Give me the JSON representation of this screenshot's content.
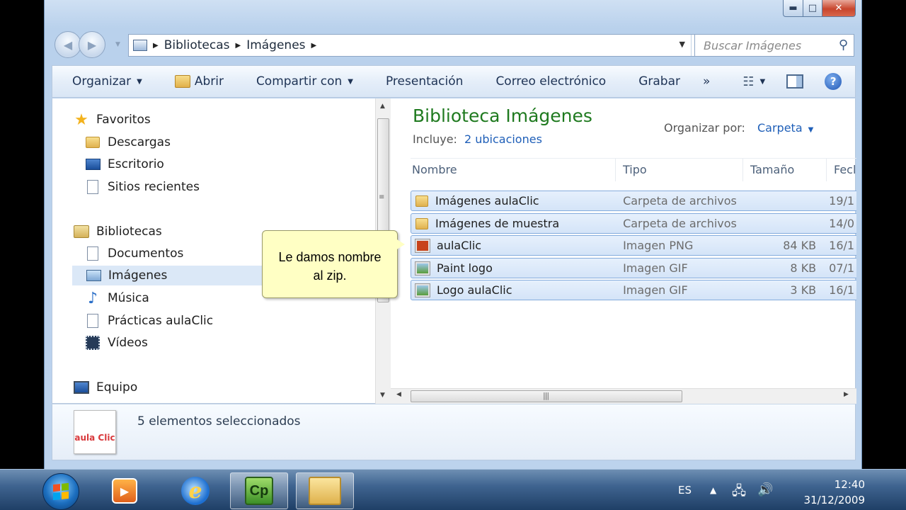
{
  "window": {
    "controls": {
      "minimize": "▬",
      "maximize": "□",
      "close": "✕"
    }
  },
  "address": {
    "crumbs": [
      "Bibliotecas",
      "Imágenes"
    ],
    "search_placeholder": "Buscar Imágenes"
  },
  "toolbar": {
    "organize": "Organizar",
    "open": "Abrir",
    "share": "Compartir con",
    "slideshow": "Presentación",
    "email": "Correo electrónico",
    "burn": "Grabar",
    "more": "»"
  },
  "nav": {
    "favorites": "Favoritos",
    "downloads": "Descargas",
    "desktop": "Escritorio",
    "recent": "Sitios recientes",
    "libraries": "Bibliotecas",
    "documents": "Documentos",
    "images": "Imágenes",
    "music": "Música",
    "practicas": "Prácticas aulaClic",
    "videos": "Vídeos",
    "computer": "Equipo"
  },
  "content": {
    "title": "Biblioteca Imágenes",
    "includes_label": "Incluye:",
    "includes_link": "2 ubicaciones",
    "arrange_label": "Organizar por:",
    "arrange_value": "Carpeta",
    "columns": [
      "Nombre",
      "Tipo",
      "Tamaño",
      "Fecl"
    ],
    "files": [
      {
        "name": "Imágenes aulaClic",
        "type": "Carpeta de archivos",
        "size": "",
        "date": "19/1",
        "icon": "folder-icon"
      },
      {
        "name": "Imágenes de muestra",
        "type": "Carpeta de archivos",
        "size": "",
        "date": "14/0",
        "icon": "folder-icon"
      },
      {
        "name": "aulaClic",
        "type": "Imagen PNG",
        "size": "84 KB",
        "date": "16/1",
        "icon": "png-file-icon"
      },
      {
        "name": "Paint logo",
        "type": "Imagen GIF",
        "size": "8 KB",
        "date": "07/1",
        "icon": "gif-file-icon"
      },
      {
        "name": "Logo aulaClic",
        "type": "Imagen GIF",
        "size": "3 KB",
        "date": "16/1",
        "icon": "gif-file-icon"
      }
    ]
  },
  "tooltip": {
    "line1": "Le damos nombre",
    "line2": "al zip."
  },
  "details": {
    "status": "5 elementos seleccionados",
    "thumb_label": "aula Clic"
  },
  "taskbar": {
    "cp_label": "Cp",
    "language": "ES",
    "time": "12:40",
    "date": "31/12/2009"
  }
}
